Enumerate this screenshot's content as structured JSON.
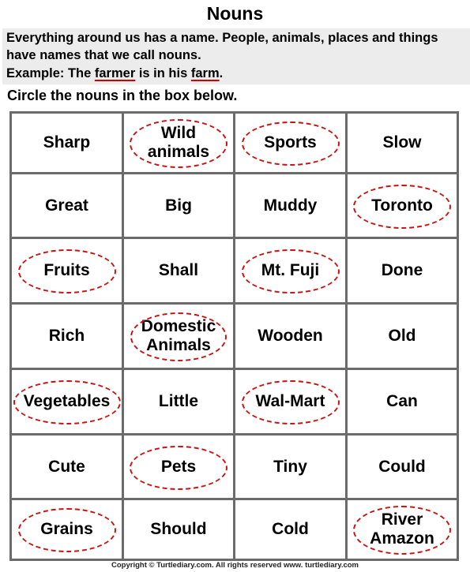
{
  "title": "Nouns",
  "intro": {
    "text": "Everything around us has a name. People, animals, places and things have names that we call nouns.",
    "example_prefix": "Example: The ",
    "example_noun1": "farmer",
    "example_mid": " is in his ",
    "example_noun2": "farm",
    "example_suffix": "."
  },
  "instruction": "Circle the nouns in the box below.",
  "grid": {
    "rows": [
      [
        {
          "text": "Sharp",
          "circled": false
        },
        {
          "text": "Wild animals",
          "circled": true
        },
        {
          "text": "Sports",
          "circled": true
        },
        {
          "text": "Slow",
          "circled": false
        }
      ],
      [
        {
          "text": "Great",
          "circled": false
        },
        {
          "text": "Big",
          "circled": false
        },
        {
          "text": "Muddy",
          "circled": false
        },
        {
          "text": "Toronto",
          "circled": true
        }
      ],
      [
        {
          "text": "Fruits",
          "circled": true
        },
        {
          "text": "Shall",
          "circled": false
        },
        {
          "text": "Mt. Fuji",
          "circled": true
        },
        {
          "text": "Done",
          "circled": false
        }
      ],
      [
        {
          "text": "Rich",
          "circled": false
        },
        {
          "text": "Domestic Animals",
          "circled": true
        },
        {
          "text": "Wooden",
          "circled": false
        },
        {
          "text": "Old",
          "circled": false
        }
      ],
      [
        {
          "text": "Vegetables",
          "circled": true
        },
        {
          "text": "Little",
          "circled": false
        },
        {
          "text": "Wal-Mart",
          "circled": true
        },
        {
          "text": "Can",
          "circled": false
        }
      ],
      [
        {
          "text": "Cute",
          "circled": false
        },
        {
          "text": "Pets",
          "circled": true
        },
        {
          "text": "Tiny",
          "circled": false
        },
        {
          "text": "Could",
          "circled": false
        }
      ],
      [
        {
          "text": "Grains",
          "circled": true
        },
        {
          "text": "Should",
          "circled": false
        },
        {
          "text": "Cold",
          "circled": false
        },
        {
          "text": "River Amazon",
          "circled": true
        }
      ]
    ]
  },
  "colors": {
    "circle": "#cc1111",
    "grid": "#6b6b6b",
    "intro_bg": "#ececec"
  },
  "footer": "Copyright © Turtlediary.com. All rights reserved   www. turtlediary.com"
}
